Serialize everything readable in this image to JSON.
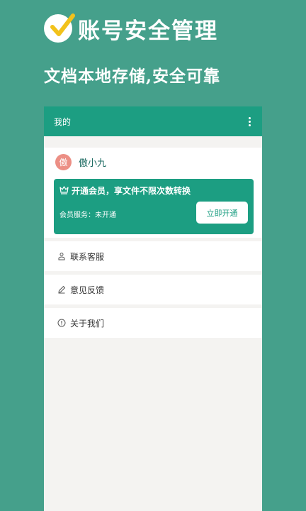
{
  "promo": {
    "title": "账号安全管理",
    "subtitle": "文档本地存储,安全可靠"
  },
  "app_bar": {
    "title": "我的",
    "menu_icon": "more-vertical-icon"
  },
  "profile": {
    "avatar_text": "傲",
    "username": "傲小九"
  },
  "vip": {
    "headline": "开通会员，享文件不限次数转换",
    "status": "会员服务：未开通",
    "button_label": "立即开通",
    "icon": "crown-icon"
  },
  "menu": {
    "items": [
      {
        "label": "联系客服",
        "icon": "customer-service-icon"
      },
      {
        "label": "意见反馈",
        "icon": "edit-icon"
      },
      {
        "label": "关于我们",
        "icon": "info-icon"
      }
    ]
  },
  "colors": {
    "background": "#45a08b",
    "primary": "#1c9e82",
    "avatar": "#ec8f85",
    "check": "#f2c21b"
  }
}
